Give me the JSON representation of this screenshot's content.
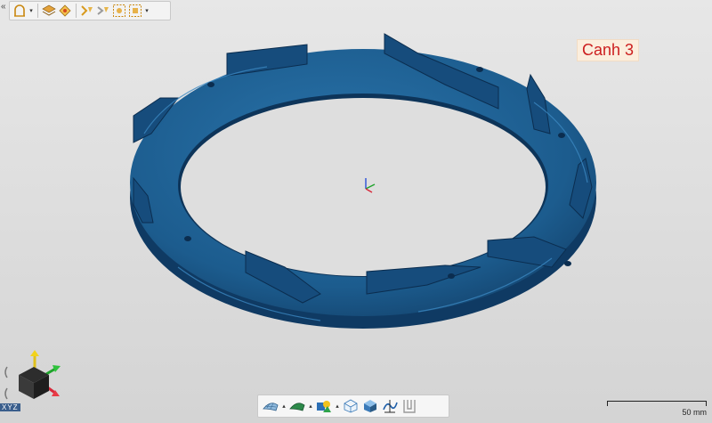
{
  "viewport": {
    "annotation_label": "Canh 3",
    "scale_label": "50 mm",
    "orientation_label": "XYZ"
  },
  "colors": {
    "model": "#1c5c8e",
    "model_dark": "#0f3a63",
    "background": "#dcdcdc",
    "annotation_text": "#cc1f1f",
    "annotation_bg": "#fbeedd"
  },
  "top_toolbar": {
    "items": [
      "align-icon",
      "dropdown-arrow",
      "layers-icon",
      "snap-icon",
      "measure-icon",
      "move-icon",
      "frame-select-icon",
      "frame-fit-icon",
      "dropdown-arrow"
    ]
  },
  "bottom_toolbar": {
    "items": [
      "mesh-render-icon",
      "shaded-render-icon",
      "color-map-icon",
      "wireframe-cube-icon",
      "solid-cube-icon",
      "section-icon",
      "profile-icon"
    ]
  }
}
